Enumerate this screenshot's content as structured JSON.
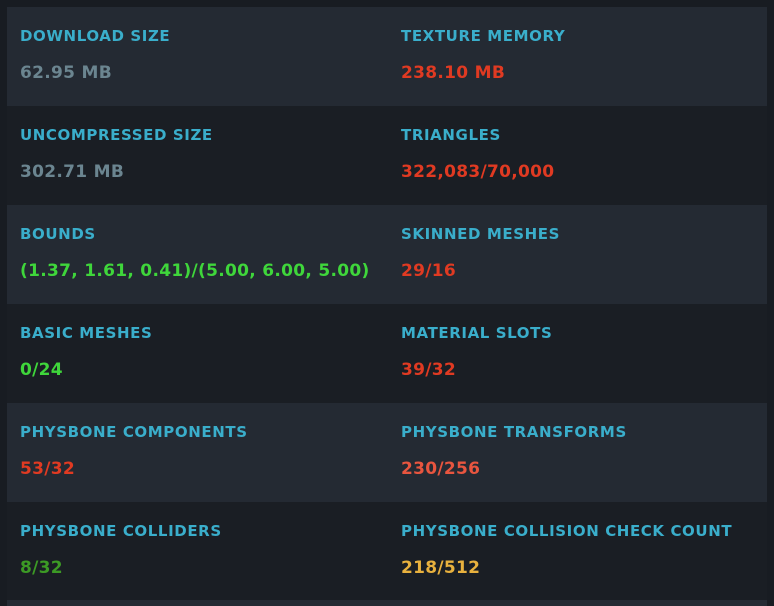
{
  "colors": {
    "label": "#3aaecb",
    "neutral": "#6b8590",
    "bad": "#e03a22",
    "poor": "#e8553f",
    "good": "#3fd63b",
    "medium": "#3c9a25",
    "warn": "#e8b13e"
  },
  "stats": [
    {
      "label": "DOWNLOAD SIZE",
      "value": "62.95 MB",
      "status": "neutral"
    },
    {
      "label": "TEXTURE MEMORY",
      "value": "238.10 MB",
      "status": "bad"
    },
    {
      "label": "UNCOMPRESSED SIZE",
      "value": "302.71 MB",
      "status": "neutral"
    },
    {
      "label": "TRIANGLES",
      "value": "322,083/70,000",
      "status": "bad"
    },
    {
      "label": "BOUNDS",
      "value": "(1.37, 1.61, 0.41)/(5.00, 6.00, 5.00)",
      "status": "good"
    },
    {
      "label": "SKINNED MESHES",
      "value": "29/16",
      "status": "bad"
    },
    {
      "label": "BASIC MESHES",
      "value": "0/24",
      "status": "good"
    },
    {
      "label": "MATERIAL SLOTS",
      "value": "39/32",
      "status": "bad"
    },
    {
      "label": "PHYSBONE COMPONENTS",
      "value": "53/32",
      "status": "bad"
    },
    {
      "label": "PHYSBONE TRANSFORMS",
      "value": "230/256",
      "status": "poor"
    },
    {
      "label": "PHYSBONE COLLIDERS",
      "value": "8/32",
      "status": "medium"
    },
    {
      "label": "PHYSBONE COLLISION CHECK COUNT",
      "value": "218/512",
      "status": "warn"
    }
  ]
}
